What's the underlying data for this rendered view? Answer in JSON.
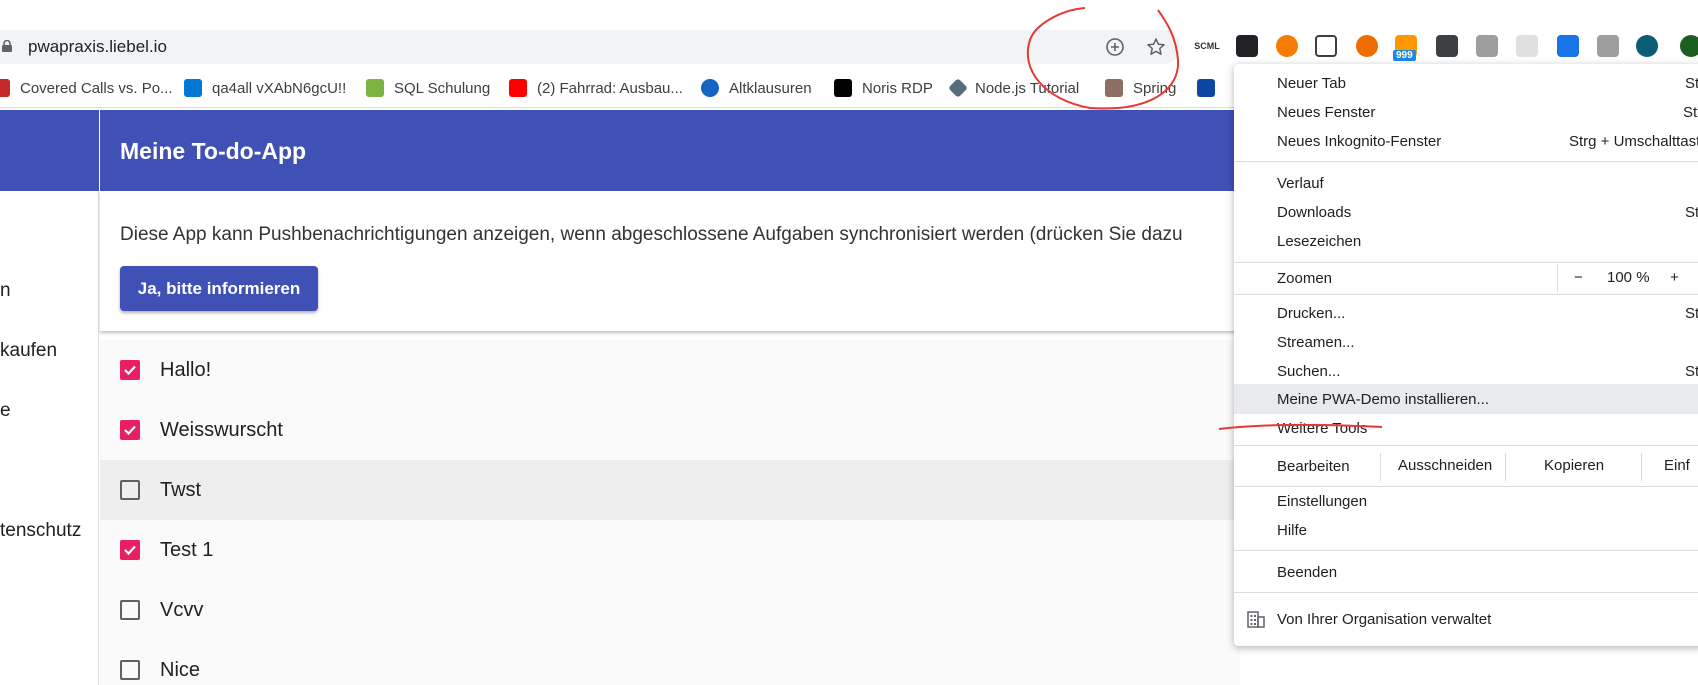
{
  "browser": {
    "url": "pwapraxis.liebel.io",
    "extension_badge": "999",
    "extension_label": "SCML",
    "bookmarks": [
      {
        "label": "Covered Calls vs. Po...",
        "color": "#c62828"
      },
      {
        "label": "qa4all vXAbN6gcU!!",
        "color": "#0078d4"
      },
      {
        "label": "SQL Schulung",
        "color": "#7cb342"
      },
      {
        "label": "(2) Fahrrad: Ausbau...",
        "color": "#ff0000"
      },
      {
        "label": "Altklausuren",
        "color": "#1565c0"
      },
      {
        "label": "Noris RDP",
        "color": "#000000"
      },
      {
        "label": "Node.js Tutorial",
        "color": "#546e7a"
      },
      {
        "label": "Spring",
        "color": "#8d6e63"
      }
    ]
  },
  "sidebar": {
    "items": [
      "n",
      " kaufen",
      "e",
      "tenschutz"
    ]
  },
  "app": {
    "title": "Meine To-do-App",
    "notice": "Diese App kann Pushbenachrichtigungen anzeigen, wenn abgeschlossene Aufgaben synchronisiert werden (drücken Sie dazu",
    "notify_button": "Ja, bitte informieren",
    "accent": "#3f51b5",
    "check_color": "#e91e63",
    "todos": [
      {
        "label": "Hallo!",
        "done": true
      },
      {
        "label": "Weisswurscht",
        "done": true
      },
      {
        "label": "Twst",
        "done": false
      },
      {
        "label": "Test 1",
        "done": true
      },
      {
        "label": "Vcvv",
        "done": false
      },
      {
        "label": "Nice",
        "done": false
      }
    ]
  },
  "menu": {
    "new_tab": "Neuer Tab",
    "new_tab_sc": "St",
    "new_window": "Neues Fenster",
    "new_window_sc": "Str",
    "incognito": "Neues Inkognito-Fenster",
    "incognito_sc": "Strg + Umschalttast",
    "history": "Verlauf",
    "downloads": "Downloads",
    "downloads_sc": "St",
    "bookmarks": "Lesezeichen",
    "zoom": "Zoomen",
    "zoom_minus": "−",
    "zoom_value": "100 %",
    "zoom_plus": "+",
    "print": "Drucken...",
    "print_sc": "St",
    "cast": "Streamen...",
    "find": "Suchen...",
    "find_sc": "St",
    "install": "Meine PWA-Demo installieren...",
    "more_tools": "Weitere Tools",
    "edit": "Bearbeiten",
    "cut": "Ausschneiden",
    "copy": "Kopieren",
    "paste": "Einf",
    "settings": "Einstellungen",
    "help": "Hilfe",
    "exit": "Beenden",
    "managed": "Von Ihrer Organisation verwaltet"
  }
}
